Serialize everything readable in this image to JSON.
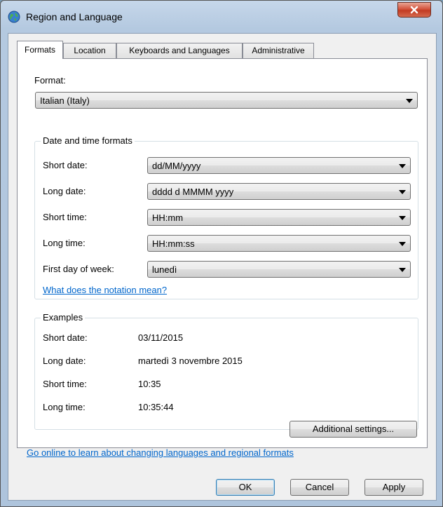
{
  "window": {
    "title": "Region and Language",
    "icon": "globe-icon",
    "close_label": "X"
  },
  "tabs": [
    {
      "label": "Formats",
      "active": true
    },
    {
      "label": "Location",
      "active": false
    },
    {
      "label": "Keyboards and Languages",
      "active": false
    },
    {
      "label": "Administrative",
      "active": false
    }
  ],
  "format": {
    "label": "Format:",
    "value": "Italian (Italy)"
  },
  "date_time_group": {
    "title": "Date and time formats",
    "rows": [
      {
        "label": "Short date:",
        "value": "dd/MM/yyyy"
      },
      {
        "label": "Long date:",
        "value": "dddd d MMMM yyyy"
      },
      {
        "label": "Short time:",
        "value": "HH:mm"
      },
      {
        "label": "Long time:",
        "value": "HH:mm:ss"
      },
      {
        "label": "First day of week:",
        "value": "lunedì"
      }
    ],
    "notation_link": "What does the notation mean?"
  },
  "examples_group": {
    "title": "Examples",
    "rows": [
      {
        "label": "Short date:",
        "value": "03/11/2015"
      },
      {
        "label": "Long date:",
        "value": "martedì 3 novembre 2015"
      },
      {
        "label": "Short time:",
        "value": "10:35"
      },
      {
        "label": "Long time:",
        "value": "10:35:44"
      }
    ]
  },
  "additional_settings_label": "Additional settings...",
  "online_link": "Go online to learn about changing languages and regional formats",
  "buttons": {
    "ok": "OK",
    "cancel": "Cancel",
    "apply": "Apply"
  },
  "colors": {
    "link": "#0066cc",
    "close_button": "#c23b22"
  }
}
